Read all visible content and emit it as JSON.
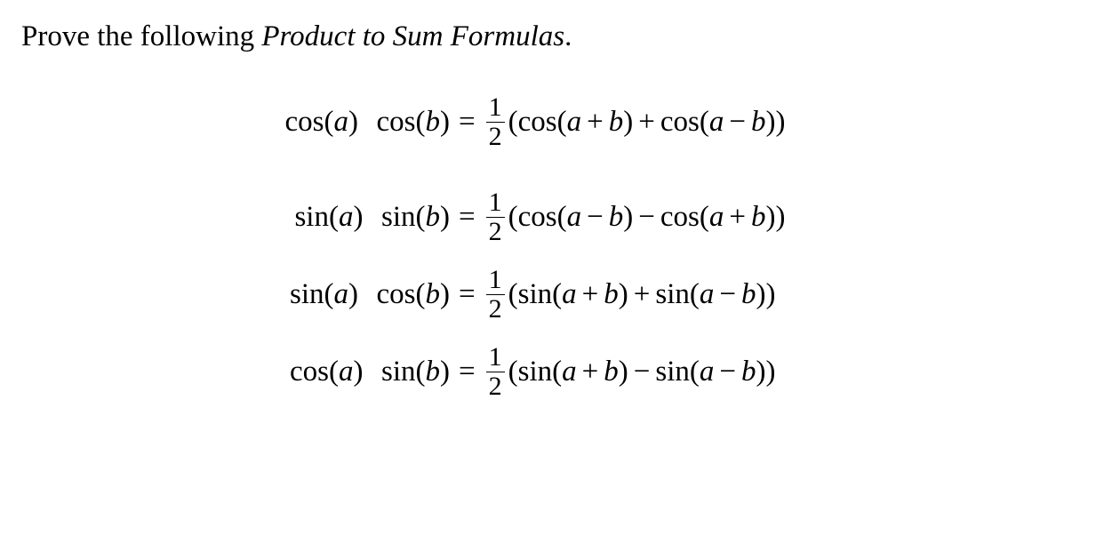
{
  "prompt": {
    "leading": "Prove the following ",
    "title_italic": "Product to Sum Formulas",
    "period": "."
  },
  "equations": {
    "extra_gap_after_first": true,
    "rows": [
      {
        "lhs": {
          "f1": "cos",
          "a1": "a",
          "f2": "cos",
          "a2": "b"
        },
        "rhs": {
          "frac_num": "1",
          "frac_den": "2",
          "t1": "cos",
          "arg1_a": "a",
          "arg1_op": "+",
          "arg1_b": "b",
          "mid_op": "+",
          "t2": "cos",
          "arg2_a": "a",
          "arg2_op": "−",
          "arg2_b": "b"
        }
      },
      {
        "lhs": {
          "f1": "sin",
          "a1": "a",
          "f2": "sin",
          "a2": "b"
        },
        "rhs": {
          "frac_num": "1",
          "frac_den": "2",
          "t1": "cos",
          "arg1_a": "a",
          "arg1_op": "−",
          "arg1_b": "b",
          "mid_op": "−",
          "t2": "cos",
          "arg2_a": "a",
          "arg2_op": "+",
          "arg2_b": "b"
        }
      },
      {
        "lhs": {
          "f1": "sin",
          "a1": "a",
          "f2": "cos",
          "a2": "b"
        },
        "rhs": {
          "frac_num": "1",
          "frac_den": "2",
          "t1": "sin",
          "arg1_a": "a",
          "arg1_op": "+",
          "arg1_b": "b",
          "mid_op": "+",
          "t2": "sin",
          "arg2_a": "a",
          "arg2_op": "−",
          "arg2_b": "b"
        }
      },
      {
        "lhs": {
          "f1": "cos",
          "a1": "a",
          "f2": "sin",
          "a2": "b"
        },
        "rhs": {
          "frac_num": "1",
          "frac_den": "2",
          "t1": "sin",
          "arg1_a": "a",
          "arg1_op": "+",
          "arg1_b": "b",
          "mid_op": "−",
          "t2": "sin",
          "arg2_a": "a",
          "arg2_op": "−",
          "arg2_b": "b"
        }
      }
    ]
  },
  "symbols": {
    "equals": "=",
    "lparen": "(",
    "rparen": ")"
  }
}
